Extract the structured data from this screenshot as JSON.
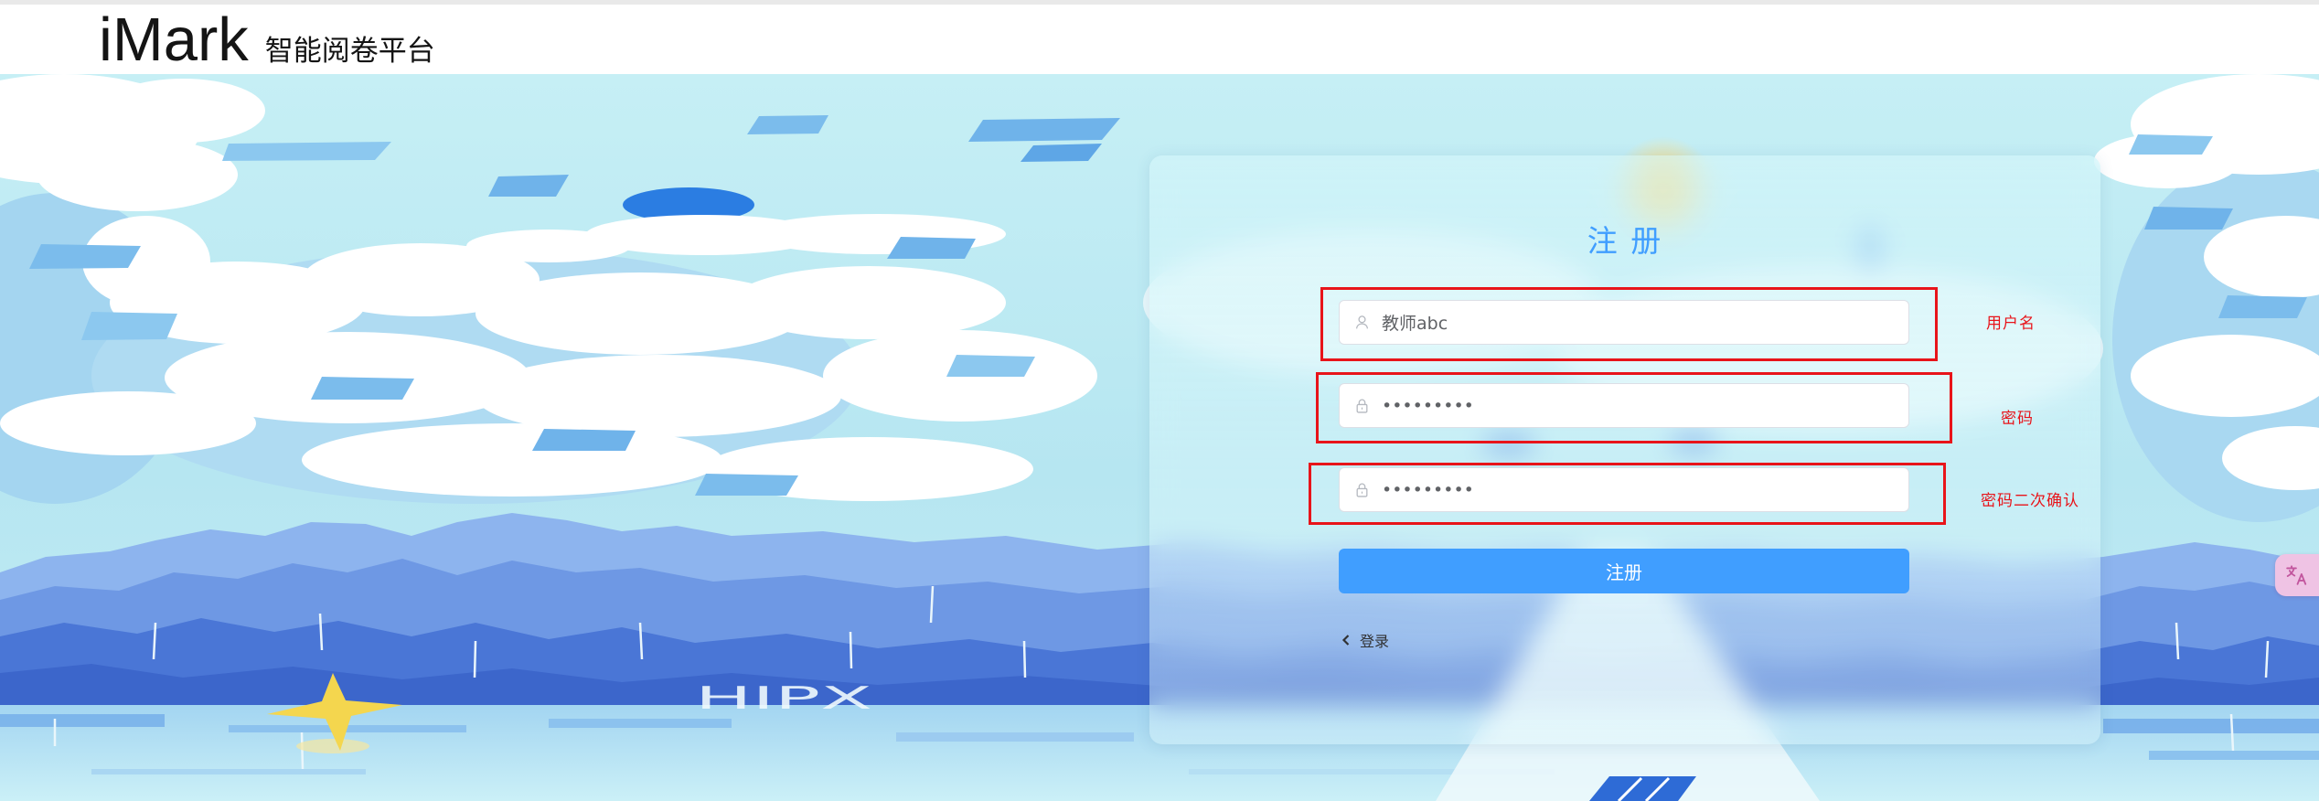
{
  "header": {
    "logo_text": "iMark",
    "subtitle": "智能阅卷平台"
  },
  "register_form": {
    "title": "注 册",
    "fields": {
      "username": {
        "value": "教师abc",
        "icon": "user-icon"
      },
      "password": {
        "value": "•••••••••",
        "icon": "lock-icon"
      },
      "confirm_password": {
        "value": "•••••••••",
        "icon": "lock-icon"
      }
    },
    "submit_label": "注册",
    "login_link": {
      "icon": "chevron-left-icon",
      "label": "登录"
    }
  },
  "annotations": [
    {
      "label": "用户名"
    },
    {
      "label": "密码"
    },
    {
      "label": "密码二次确认"
    }
  ],
  "background": {
    "watermark_text": "HIPX"
  },
  "floating_widget": {
    "icon": "translate-icon"
  },
  "colors": {
    "accent": "#409eff",
    "annotation": "#e8141a",
    "header_bg": "#ffffff",
    "input_text": "#606266"
  }
}
